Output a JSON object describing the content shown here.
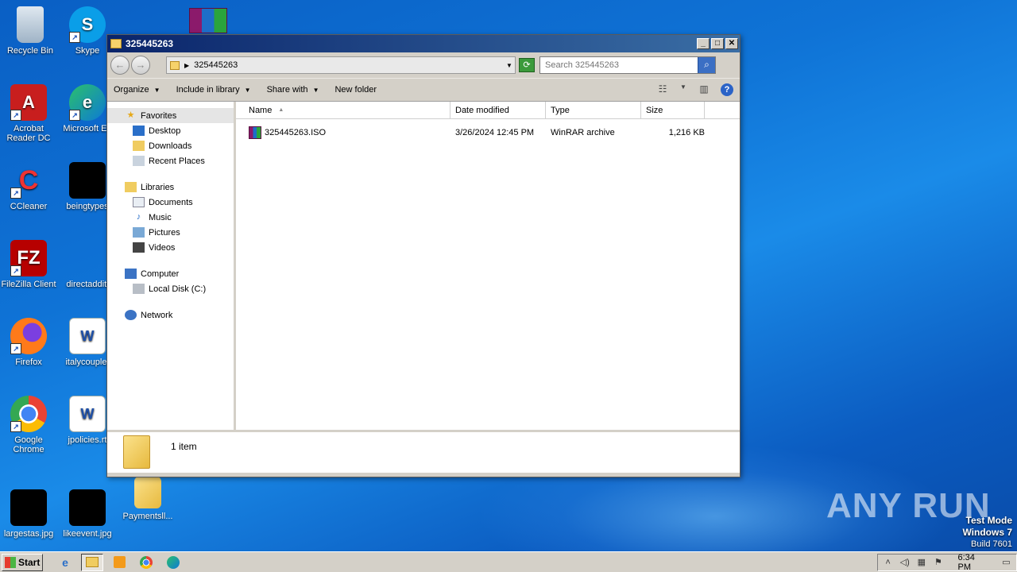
{
  "desktop": {
    "icons": [
      {
        "label": "Recycle Bin",
        "icon": "recycle-bin-icon"
      },
      {
        "label": "Skype",
        "icon": "skype-icon"
      },
      {
        "label": "Acrobat Reader DC",
        "icon": "acrobat-icon"
      },
      {
        "label": "Microsoft Ed",
        "icon": "edge-icon"
      },
      {
        "label": "CCleaner",
        "icon": "ccleaner-icon"
      },
      {
        "label": "beingtypes",
        "icon": "image-file-icon"
      },
      {
        "label": "FileZilla Client",
        "icon": "filezilla-icon"
      },
      {
        "label": "directadditi",
        "icon": "image-file-icon"
      },
      {
        "label": "Firefox",
        "icon": "firefox-icon"
      },
      {
        "label": "italycouple.",
        "icon": "word-doc-icon"
      },
      {
        "label": "Google Chrome",
        "icon": "chrome-icon"
      },
      {
        "label": "jpolicies.rt",
        "icon": "word-doc-icon"
      },
      {
        "label": "largestas.jpg",
        "icon": "image-file-icon"
      },
      {
        "label": "likeevent.jpg",
        "icon": "image-file-icon"
      },
      {
        "label": "Paymentsll...",
        "icon": "folder-icon"
      }
    ],
    "watermark": "ANY RUN",
    "test_mode": {
      "line1": "Test Mode",
      "line2": "Windows 7",
      "line3": "Build 7601"
    }
  },
  "window": {
    "title": "325445263",
    "address_path": "325445263",
    "search_placeholder": "Search 325445263",
    "toolbar": {
      "organize": "Organize",
      "include": "Include in library",
      "share": "Share with",
      "new_folder": "New folder"
    },
    "nav": {
      "favorites": "Favorites",
      "favorites_items": [
        "Desktop",
        "Downloads",
        "Recent Places"
      ],
      "libraries": "Libraries",
      "libraries_items": [
        "Documents",
        "Music",
        "Pictures",
        "Videos"
      ],
      "computer": "Computer",
      "computer_items": [
        "Local Disk (C:)"
      ],
      "network": "Network"
    },
    "columns": {
      "name": "Name",
      "date": "Date modified",
      "type": "Type",
      "size": "Size"
    },
    "files": [
      {
        "name": "325445263.ISO",
        "date": "3/26/2024 12:45 PM",
        "type": "WinRAR archive",
        "size": "1,216 KB"
      }
    ],
    "status": "1 item"
  },
  "taskbar": {
    "start": "Start",
    "clock": "6:34 PM"
  }
}
